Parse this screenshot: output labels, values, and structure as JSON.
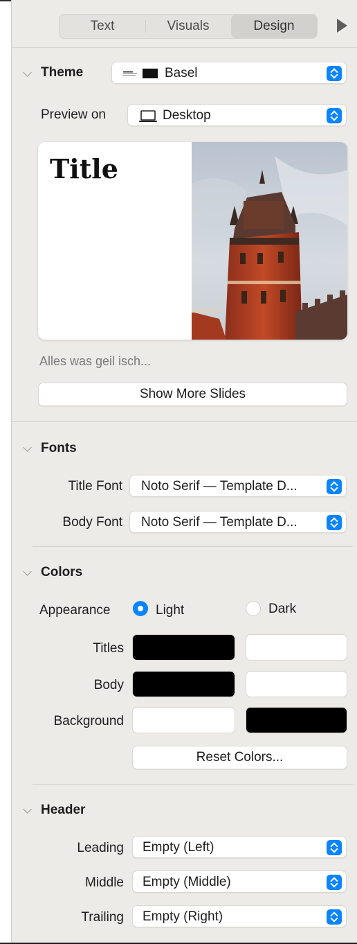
{
  "tabs": [
    {
      "label": "Text",
      "active": false
    },
    {
      "label": "Visuals",
      "active": false
    },
    {
      "label": "Design",
      "active": true
    }
  ],
  "theme": {
    "section_title": "Theme",
    "selected": "Basel",
    "preview_label": "Preview on",
    "preview_device": "Desktop"
  },
  "preview": {
    "slide_title": "Title",
    "caption": "Alles was geil isch...",
    "show_more_label": "Show More Slides"
  },
  "fonts": {
    "section_title": "Fonts",
    "title_font_label": "Title Font",
    "title_font_value": "Noto Serif — Template D...",
    "body_font_label": "Body Font",
    "body_font_value": "Noto Serif — Template D..."
  },
  "colors": {
    "section_title": "Colors",
    "appearance_label": "Appearance",
    "light_label": "Light",
    "dark_label": "Dark",
    "selected_appearance": "Light",
    "rows": [
      {
        "label": "Titles",
        "light": "#000000",
        "dark": "#ffffff"
      },
      {
        "label": "Body",
        "light": "#000000",
        "dark": "#ffffff"
      },
      {
        "label": "Background",
        "light": "#ffffff",
        "dark": "#000000"
      }
    ],
    "reset_label": "Reset Colors..."
  },
  "header": {
    "section_title": "Header",
    "leading_label": "Leading",
    "leading_value": "Empty (Left)",
    "middle_label": "Middle",
    "middle_value": "Empty (Middle)",
    "trailing_label": "Trailing",
    "trailing_value": "Empty (Right)"
  },
  "accent_color": "#0a84ff",
  "icons": [
    "play-icon",
    "chevron-down-icon",
    "laptop-icon",
    "stepper-icon",
    "radio-icon"
  ]
}
